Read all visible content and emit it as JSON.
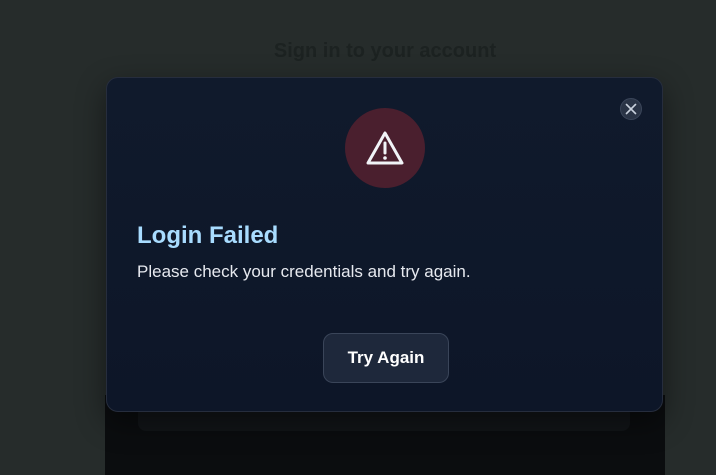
{
  "background": {
    "heading": "Sign in to your account"
  },
  "modal": {
    "icon": "warning-triangle-icon",
    "title": "Login Failed",
    "message": "Please check your credentials and try again.",
    "button_label": "Try Again",
    "close_icon": "close-icon"
  },
  "colors": {
    "title": "#a8dcff",
    "icon_bg": "#4a1f2e",
    "modal_bg": "#0f192b",
    "button_bg": "#1e283b"
  }
}
